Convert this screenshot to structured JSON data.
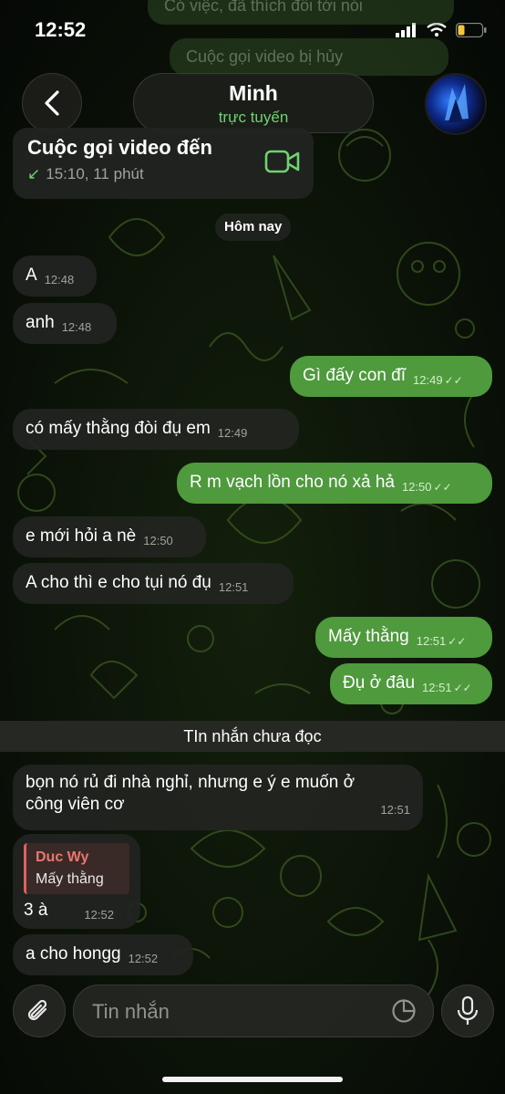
{
  "status_bar": {
    "time": "12:52"
  },
  "ghost_messages": [
    "Có việc, đã thích đối tới nói",
    "Cuộc gọi video bị hủy"
  ],
  "header": {
    "name": "Minh",
    "status": "trực tuyến"
  },
  "call_card": {
    "title": "Cuộc gọi video đến",
    "detail": "15:10, 11 phút",
    "arrow": "↙"
  },
  "date_chip": "Hôm nay",
  "messages": [
    {
      "text": "A",
      "time": "12:48"
    },
    {
      "text": "anh",
      "time": "12:48"
    },
    {
      "text": "Gì đấy con đĩ",
      "time": "12:49"
    },
    {
      "text": "có mấy thằng đòi đụ em",
      "time": "12:49"
    },
    {
      "text": "R m vạch lồn cho nó xả hả",
      "time": "12:50"
    },
    {
      "text": "e mới hỏi a nè",
      "time": "12:50"
    },
    {
      "text": "A cho thì e cho tụi nó đụ",
      "time": "12:51"
    },
    {
      "text": "Mấy thằng",
      "time": "12:51"
    },
    {
      "text": "Đụ ở đâu",
      "time": "12:51"
    },
    {
      "line1": "bọn nó rủ đi nhà nghỉ, nhưng e ý e muốn ở",
      "line2": "công viên cơ",
      "time": "12:51"
    },
    {
      "reply_name": "Duc Wy",
      "reply_text": "Mấy thằng",
      "text": "3 à",
      "time": "12:52"
    },
    {
      "text": "a cho hongg",
      "time": "12:52"
    }
  ],
  "unread_label": "TIn nhắn chưa đọc",
  "composer": {
    "placeholder": "Tin nhắn"
  },
  "colors": {
    "outgoing": "#4e9a3d",
    "incoming": "#222421",
    "online": "#6fd36f",
    "reply_accent": "#e0605a"
  }
}
